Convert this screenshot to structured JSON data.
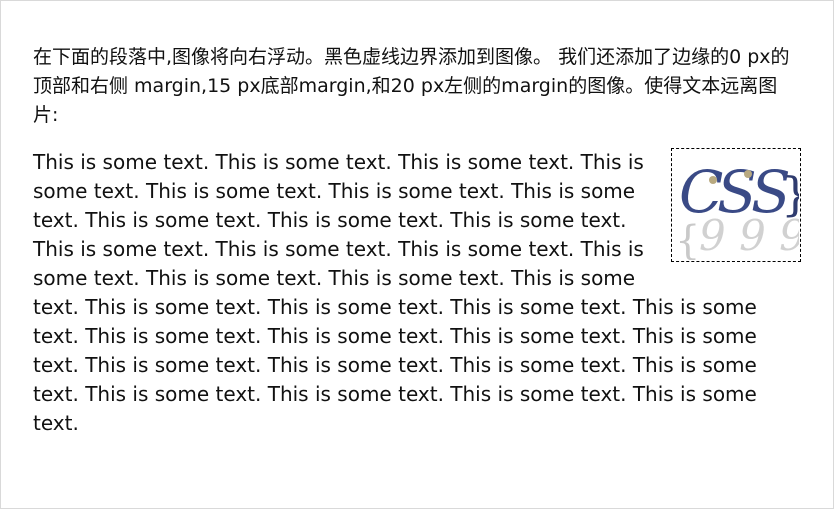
{
  "intro": "在下面的段落中,图像将向右浮动。黑色虚线边界添加到图像。 我们还添加了边缘的0 px的顶部和右侧 margin,15 px底部margin,和20 px左侧的margin的图像。使得文本远离图片:",
  "logo": {
    "text": "CSS",
    "open_brace": "{",
    "close_brace": "}",
    "colors": {
      "letters": "#3a4a86",
      "dots": "#b8a980",
      "brace": "#2f3b6e",
      "reflection": "#c9c9c9"
    }
  },
  "paragraph": "This is some text. This is some text. This is some text. This is some text. This is some text. This is some text. This is some text. This is some text. This is some text. This is some text. This is some text. This is some text. This is some text. This is some text. This is some text. This is some text. This is some text. This is some text. This is some text. This is some text. This is some text. This is some text. This is some text. This is some text. This is some text. This is some text. This is some text. This is some text. This is some text. This is some text. This is some text. This is some text. This is some text."
}
